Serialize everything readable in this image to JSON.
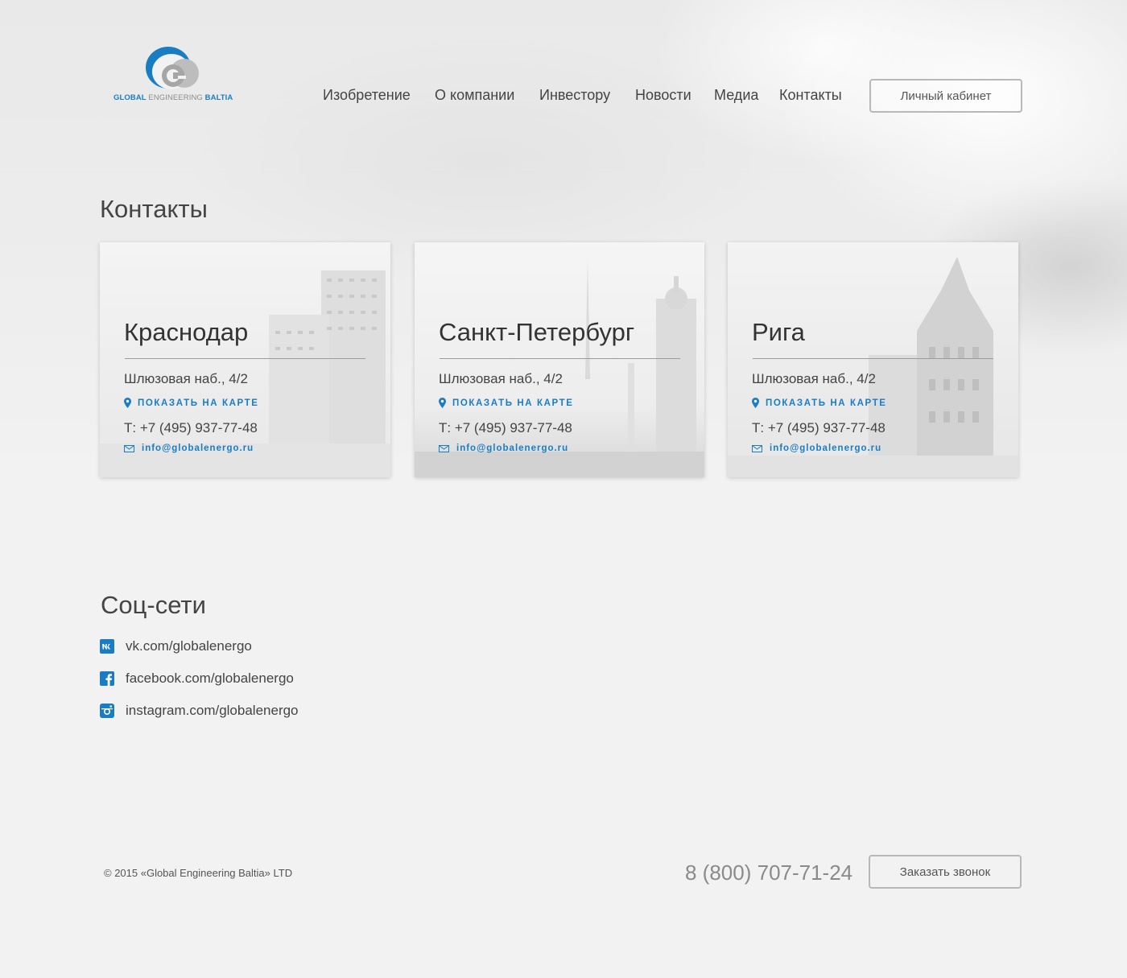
{
  "brand": {
    "part1": "GLOBAL",
    "part2": "ENGINEERING",
    "part3": "BALTIA"
  },
  "nav": [
    "Изобретение",
    "О компании",
    "Инвестору",
    "Новости",
    "Медиа",
    "Контакты"
  ],
  "header": {
    "cabinet_label": "Личный кабинет"
  },
  "contacts": {
    "title": "Контакты",
    "cards": [
      {
        "city": "Краснодар",
        "address": "Шлюзовая наб., 4/2",
        "map_link": "ПОКАЗАТЬ НА КАРТЕ",
        "phone": "Т: +7 (495) 937-77-48",
        "email": "info@globalenergo.ru"
      },
      {
        "city": "Санкт-Петербург",
        "address": "Шлюзовая наб., 4/2",
        "map_link": "ПОКАЗАТЬ НА КАРТЕ",
        "phone": "Т: +7 (495) 937-77-48",
        "email": "info@globalenergo.ru"
      },
      {
        "city": "Рига",
        "address": "Шлюзовая наб., 4/2",
        "map_link": "ПОКАЗАТЬ НА КАРТЕ",
        "phone": "Т: +7 (495) 937-77-48",
        "email": "info@globalenergo.ru"
      }
    ]
  },
  "social": {
    "title": "Соц-сети",
    "links": [
      {
        "icon": "vk-icon",
        "label": "vk.com/globalenergo"
      },
      {
        "icon": "facebook-icon",
        "label": "facebook.com/globalenergo"
      },
      {
        "icon": "instagram-icon",
        "label": "instagram.com/globalenergo"
      }
    ]
  },
  "footer": {
    "copyright": "© 2015 «Global Engineering Baltia» LTD",
    "phone": "8 (800) 707-71-24",
    "callback_label": "Заказать звонок"
  },
  "colors": {
    "accent": "#1a7dc4",
    "background": "#f2f2f2",
    "text": "#3b3b3b"
  }
}
